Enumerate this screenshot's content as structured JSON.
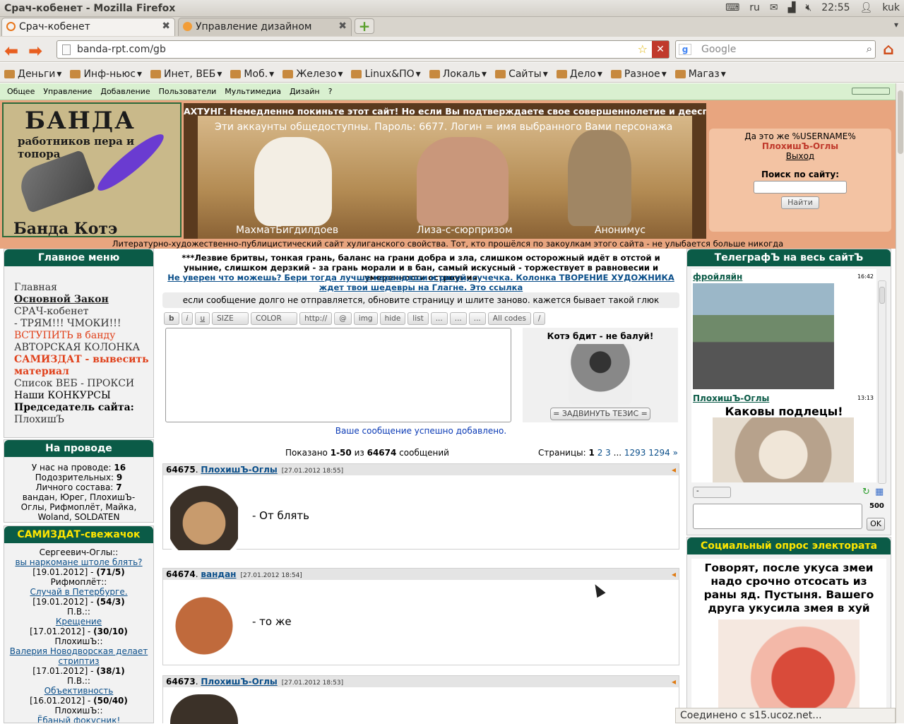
{
  "window": {
    "title": "Срач-кобенет - Mozilla Firefox",
    "tray": {
      "keyboard": "ru",
      "time": "22:55",
      "user": "kuk"
    }
  },
  "tabs": [
    {
      "label": "Срач-кобенет"
    },
    {
      "label": "Управление дизайном"
    }
  ],
  "nav": {
    "url": "banda-rpt.com/gb",
    "search_placeholder": "Google"
  },
  "bookmarks": [
    "Деньги",
    "Инф-ньюс",
    "Инет, ВЕБ",
    "Моб.",
    "Железо",
    "Linux&ПО",
    "Локаль",
    "Сайты",
    "Дело",
    "Разное",
    "Магаз"
  ],
  "site_menu": [
    "Общее",
    "Управление",
    "Добавление",
    "Пользователи",
    "Мультимедиа",
    "Дизайн",
    "?"
  ],
  "header": {
    "logo_title": "БАНДА",
    "logo_sub": "работников пера и топора",
    "logo_bottom": "Банда Котэ",
    "ahtung": "АХТУНГ: Немедленно покиньте этот сайт! Но если Вы подтверждаете свое совершеннолетие и дееспособность,",
    "accounts_info": "Эти аккаунты  общедоступны. Пароль: 6677. Логин = имя выбранного Вами персонажа",
    "characters": [
      "МахматБигдилдоев",
      "Лиза-с-сюрпризом",
      "Анонимус"
    ],
    "slogan": "Литературно-художественно-публицистический сайт хулиганского свойства. Тот, кто прошёлся по закоулкам этого сайта - не улыбается больше никогда"
  },
  "login": {
    "greeting": "Да это же %USERNAME%",
    "username": "ПлохишЪ-Оглы",
    "logout": "Выход",
    "search_label": "Поиск по сайту:",
    "search_button": "Найти"
  },
  "main_menu": {
    "title": "Главное меню",
    "items": [
      {
        "label": "Главная",
        "style": "normal"
      },
      {
        "label": "Основной Закон",
        "style": "boldu"
      },
      {
        "label": "СРАЧ-кобенет",
        "style": "normal"
      },
      {
        "label": "- ТРЯМ!!! ЧМОКИ!!!",
        "style": "normal"
      },
      {
        "label": "ВСТУПИТЬ в банду",
        "style": "red"
      },
      {
        "label": "АВТОРСКАЯ КОЛОНКА",
        "style": "normal"
      },
      {
        "label": "САМИЗДАТ - вывесить материал",
        "style": "redbold"
      },
      {
        "label": "Список ВЕБ - ПРОКСИ",
        "style": "normal"
      },
      {
        "label": "Наши КОНКУРСЫ",
        "style": "dark"
      },
      {
        "label": "Председатель сайта:",
        "style": "bold"
      },
      {
        "label": "ПлохишЪ",
        "style": "normal"
      }
    ]
  },
  "online": {
    "title": "На проводе",
    "label_online": "У нас на проводе:",
    "online": "16",
    "label_susp": "Подозрительных:",
    "susp": "9",
    "label_staff": "Личного состава:",
    "staff": "7",
    "users": "вандан, Юрег, ПлохишЪ-Оглы, Рифмоплёт, Майка, Woland, SOLDATEN"
  },
  "samizdat": {
    "title": "САМИЗДАТ-свежачок",
    "items": [
      {
        "author": "Сергеевич-Оглы::",
        "title": "вы наркомане штоле блять?",
        "date": "[19.01.2012]",
        "score": "(71/5)"
      },
      {
        "author": "Рифмоплёт::",
        "title": "Случай в Петербурге.",
        "date": "[19.01.2012]",
        "score": "(54/3)"
      },
      {
        "author": "П.В.::",
        "title": "Крещение",
        "date": "[17.01.2012]",
        "score": "(30/10)"
      },
      {
        "author": "ПлохишЪ::",
        "title": "Валерия Новодворская делает стриптиз",
        "date": "[17.01.2012]",
        "score": "(38/1)"
      },
      {
        "author": "П.В.::",
        "title": "Объективность",
        "date": "[16.01.2012]",
        "score": "(50/40)"
      },
      {
        "author": "ПлохишЪ::",
        "title": "Ёбаный фокусник!",
        "date": "",
        "score": ""
      }
    ]
  },
  "center": {
    "notice": "***Лезвие бритвы, тонкая грань, баланс на грани добра и зла, слишком осторожный идёт в отстой и уныние, слишком дерзкий - за грань морали и в бан, самый искусный - торжествует в равновесии и умеренности остроумия",
    "notice_link": "Не уверен что можешь? Бери тогда лучше карандаши и рисуй, сучечка. Колонка ТВОРЕНИЕ ХУДОЖНИКА ждет твои шедевры на Глагне. Это ссылка",
    "warning": "если сообщение долго не отправляется, обновите страницу и шлите заново. кажется бывает такой глюк",
    "bbcodes": [
      "b",
      "i",
      "u",
      "SIZE",
      "COLOR",
      "http://",
      "@",
      "img",
      "hide",
      "list",
      "...",
      "...",
      "...",
      "All codes",
      "/"
    ],
    "kote_title": "Котэ бдит - не балуй!",
    "submit": "= ЗАДВИНУТЬ ТЕЗИС =",
    "success": "Ваше сообщение успешно добавлено.",
    "shown_prefix": "Показано",
    "shown_range": "1-50",
    "shown_of": "из",
    "shown_total": "64674",
    "shown_suffix": "сообщений",
    "pages_label": "Страницы:",
    "pages": [
      "1",
      "2",
      "3",
      "...",
      "1293",
      "1294",
      "»"
    ],
    "posts": [
      {
        "num": "64675",
        "author": "ПлохишЪ-Оглы",
        "date": "[27.01.2012 18:55]",
        "text": "- От блять"
      },
      {
        "num": "64674",
        "author": "вандан",
        "date": "[27.01.2012 18:54]",
        "text": "- то же"
      },
      {
        "num": "64673",
        "author": "ПлохишЪ-Оглы",
        "date": "[27.01.2012 18:53]",
        "text": ""
      }
    ]
  },
  "telegraph": {
    "title": "ТелеграфЪ на весь сайтЪ",
    "messages": [
      {
        "author": "фройляйн",
        "time": "16:42",
        "caption": ""
      },
      {
        "author": "ПлохишЪ-Оглы",
        "time": "13:13",
        "caption": "Каковы подлецы!"
      }
    ],
    "counter": "500",
    "ok": "OK",
    "select": "-"
  },
  "poll": {
    "title": "Социальный опрос электората",
    "question": "Говорят, после укуса змеи надо срочно отсосать из раны яд. Пустыня. Вашего друга укусила змея в хуй"
  },
  "status": "Соединено с s15.ucoz.net..."
}
